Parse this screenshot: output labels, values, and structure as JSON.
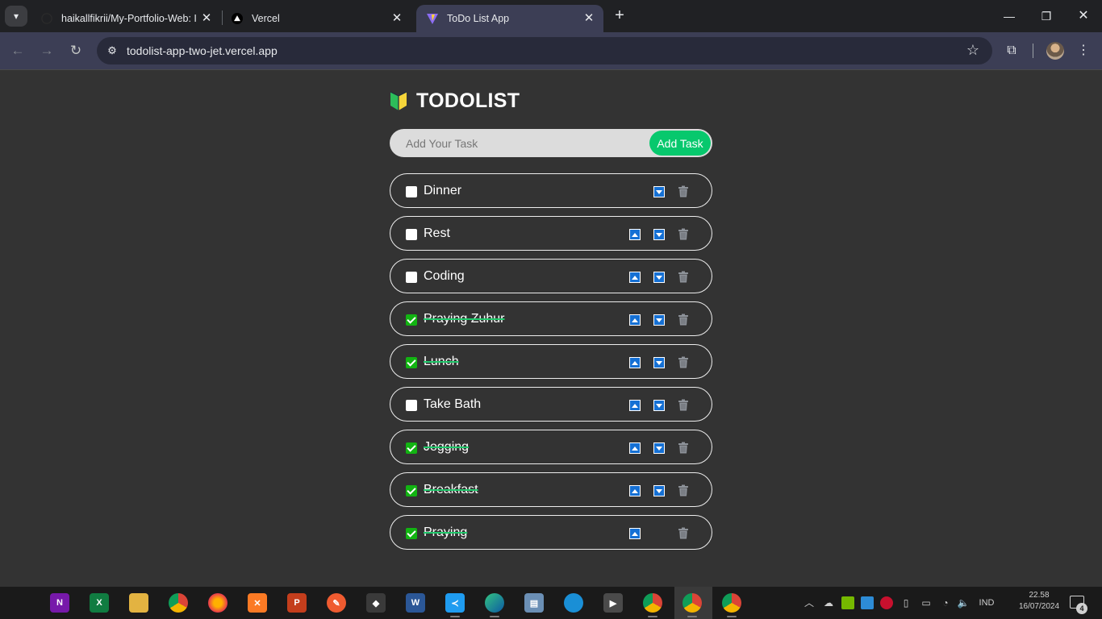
{
  "browser": {
    "tabs": [
      {
        "title": "haikallfikrii/My-Portfolio-Web: I",
        "favicon": "github-icon",
        "active": false
      },
      {
        "title": "Vercel",
        "favicon": "vercel-triangle-icon",
        "active": false
      },
      {
        "title": "ToDo List App",
        "favicon": "vite-icon",
        "active": true
      }
    ],
    "url": "todolist-app-two-jet.vercel.app"
  },
  "app": {
    "brand_icon": "beginner-shield-icon",
    "title": "TODOLIST",
    "input_placeholder": "Add Your Task",
    "add_button_label": "Add Task",
    "colors": {
      "background": "#333333",
      "add_button": "#07c86d",
      "checked": "#12b412",
      "arrow_button": "#1570d4",
      "strike": "#20c76a"
    },
    "tasks": [
      {
        "text": "Dinner",
        "done": false,
        "show_up": false,
        "show_down": true
      },
      {
        "text": "Rest",
        "done": false,
        "show_up": true,
        "show_down": true
      },
      {
        "text": "Coding",
        "done": false,
        "show_up": true,
        "show_down": true
      },
      {
        "text": "Praying Zuhur",
        "done": true,
        "show_up": true,
        "show_down": true
      },
      {
        "text": "Lunch",
        "done": true,
        "show_up": true,
        "show_down": true
      },
      {
        "text": "Take Bath",
        "done": false,
        "show_up": true,
        "show_down": true
      },
      {
        "text": "Jogging",
        "done": true,
        "show_up": true,
        "show_down": true
      },
      {
        "text": "Breakfast",
        "done": true,
        "show_up": true,
        "show_down": true
      },
      {
        "text": "Praying",
        "done": true,
        "show_up": true,
        "show_down": false
      }
    ]
  },
  "taskbar": {
    "tray_language": "IND",
    "clock_time": "22.58",
    "clock_date": "16/07/2024",
    "notification_count": "4"
  }
}
